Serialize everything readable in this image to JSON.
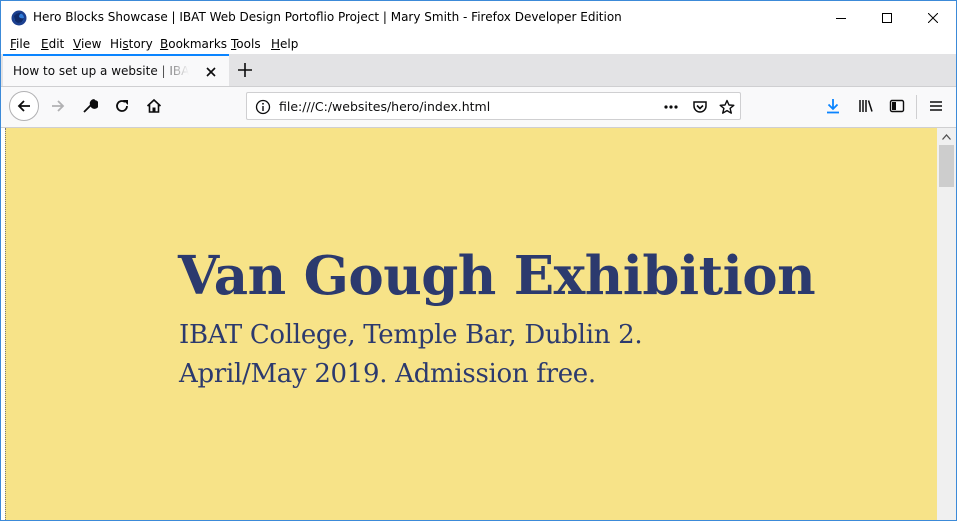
{
  "window": {
    "title": "Hero Blocks Showcase | IBAT Web Design Portoflio Project | Mary Smith - Firefox Developer Edition",
    "buttons": {
      "minimize": "minimize-icon",
      "maximize": "maximize-icon",
      "close": "close-icon"
    }
  },
  "menu": {
    "items": [
      {
        "label": "File",
        "accel": "F",
        "rest": "ile"
      },
      {
        "label": "Edit",
        "accel": "E",
        "rest": "dit"
      },
      {
        "label": "View",
        "accel": "V",
        "rest": "iew"
      },
      {
        "label": "History",
        "accel": "",
        "pre": "Hi",
        "mid": "s",
        "post": "tory"
      },
      {
        "label": "Bookmarks",
        "accel": "B",
        "rest": "ookmarks"
      },
      {
        "label": "Tools",
        "accel": "T",
        "rest": "ools"
      },
      {
        "label": "Help",
        "accel": "H",
        "rest": "elp"
      }
    ]
  },
  "tab": {
    "label": "How to set up a website | IBAT Portfolio",
    "active_color": "#0a84ff"
  },
  "navbar": {
    "url": "file:///C:/websites/hero/index.html",
    "download_color": "#0a84ff"
  },
  "page": {
    "title": "Van Gough Exhibition",
    "line1": "IBAT College, Temple Bar, Dublin 2.",
    "line2": "April/May 2019. Admission free.",
    "background": "#f7e388",
    "text_color": "#2c3a6e"
  }
}
